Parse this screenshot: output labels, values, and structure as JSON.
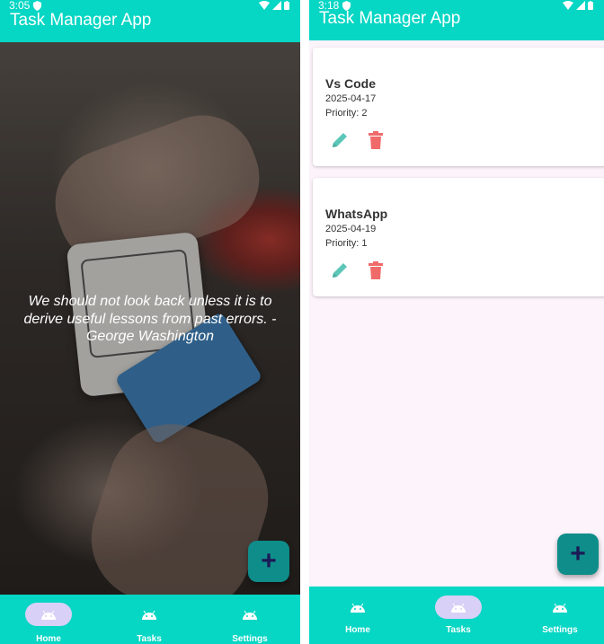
{
  "left": {
    "status_time": "3:05",
    "app_title": "Task Manager App",
    "quote": "We should not look back unless it is to derive useful lessons from past errors. - George Washington",
    "fab_label": "+",
    "nav": [
      {
        "label": "Home",
        "active": true
      },
      {
        "label": "Tasks",
        "active": false
      },
      {
        "label": "Settings",
        "active": false
      }
    ]
  },
  "right": {
    "status_time": "3:18",
    "app_title": "Task Manager App",
    "tasks": [
      {
        "name": "Vs Code",
        "date": "2025-04-17",
        "priority": "Priority: 2"
      },
      {
        "name": "WhatsApp",
        "date": "2025-04-19",
        "priority": "Priority: 1"
      }
    ],
    "fab_label": "+",
    "nav": [
      {
        "label": "Home",
        "active": false
      },
      {
        "label": "Tasks",
        "active": true
      },
      {
        "label": "Settings",
        "active": false
      }
    ]
  },
  "colors": {
    "app_bar": "#06d6c4",
    "fab": "#0e8d8a",
    "nav_active_pill": "#d8d0f6",
    "edit_icon": "#5cc6b8",
    "delete_icon": "#f06a6a"
  },
  "icons": {
    "nav": "android-icon",
    "edit": "pencil-icon",
    "delete": "trash-icon",
    "fab": "plus-icon"
  }
}
